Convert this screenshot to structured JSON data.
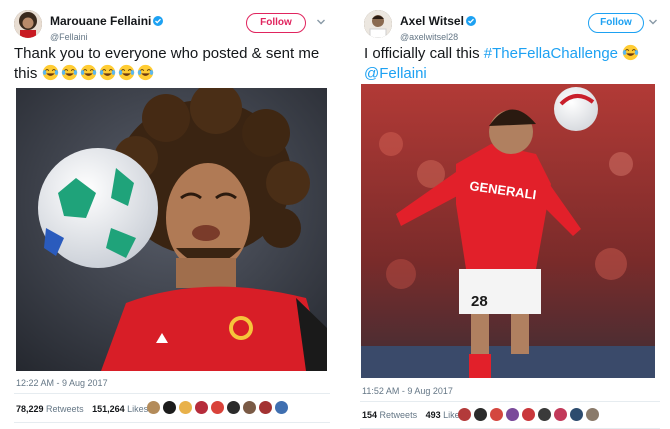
{
  "left_tweet": {
    "display_name": "Marouane Fellaini",
    "handle": "@Fellaini",
    "follow_label": "Follow",
    "text": "Thank you to everyone who posted & sent me this",
    "emoji_count_label": "😂😂😂😂😂😂",
    "timestamp": "12:22 AM - 9 Aug 2017",
    "retweets_count": "78,229",
    "retweets_label": "Retweets",
    "likes_count": "151,264",
    "likes_label": "Likes",
    "accent_color": "#e0245e",
    "photo_icon": "football-header-photo"
  },
  "right_tweet": {
    "display_name": "Axel Witsel",
    "handle": "@axelwitsel28",
    "follow_label": "Follow",
    "text_prefix": "I officially call this ",
    "hashtag": "#TheFellaChallenge",
    "mention": "@Fellaini",
    "timestamp": "11:52 AM - 9 Aug 2017",
    "retweets_count": "154",
    "retweets_label": "Retweets",
    "likes_count": "493",
    "likes_label": "Likes",
    "accent_color": "#1da1f2",
    "photo_icon": "football-header-photo",
    "jersey_text": "GENERALI",
    "jersey_number": "28"
  },
  "colors": {
    "link": "#1da1f2",
    "secondary_text": "#657786",
    "verified": "#1da1f2"
  }
}
